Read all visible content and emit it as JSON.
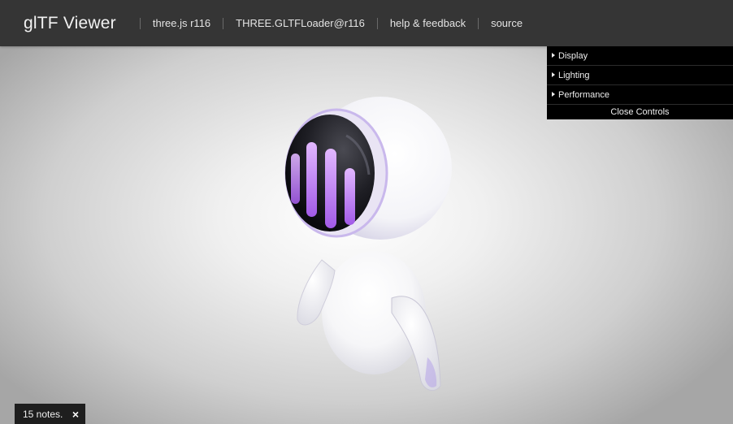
{
  "header": {
    "title": "glTF Viewer",
    "links": [
      {
        "label": "three.js r116"
      },
      {
        "label": "THREE.GLTFLoader@r116"
      },
      {
        "label": "help & feedback"
      },
      {
        "label": "source"
      }
    ]
  },
  "controls": {
    "folders": [
      {
        "label": "Display"
      },
      {
        "label": "Lighting"
      },
      {
        "label": "Performance"
      }
    ],
    "close_label": "Close Controls"
  },
  "notes": {
    "text": "15 notes.",
    "close_label": "×"
  },
  "colors": {
    "header_bg": "#353535",
    "panel_bg": "#000000",
    "visor_glow": "#c58af5"
  }
}
